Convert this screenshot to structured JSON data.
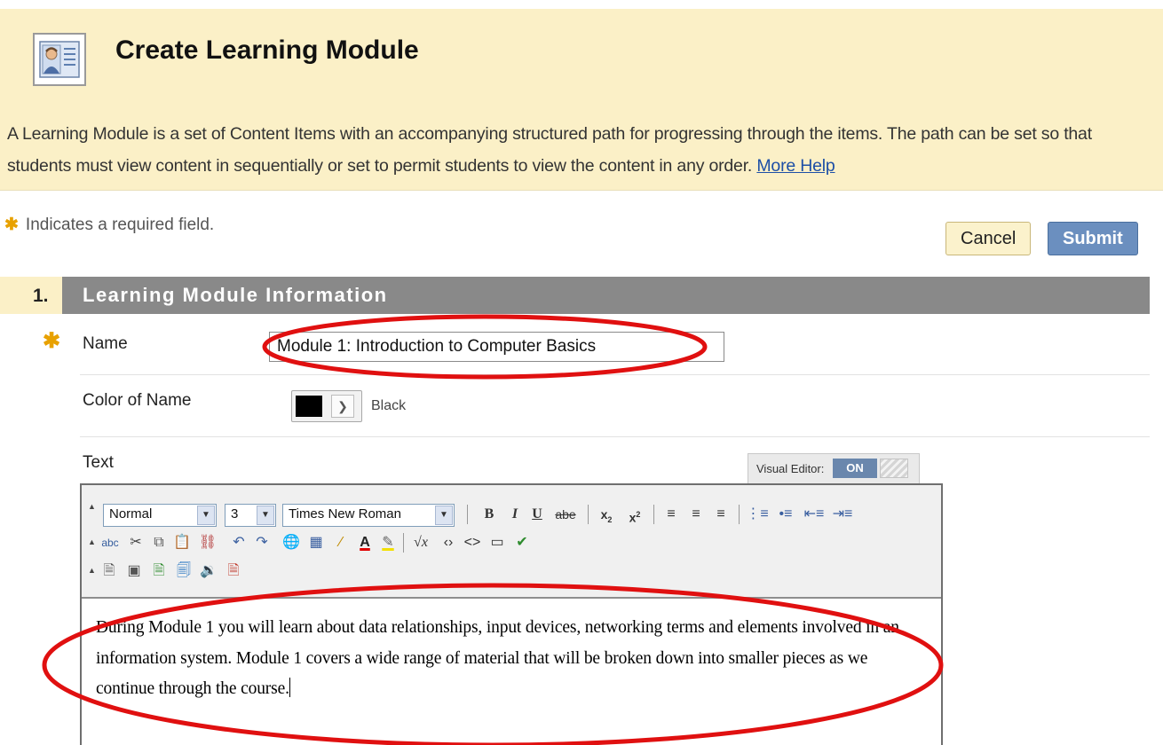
{
  "header": {
    "title": "Create Learning Module",
    "intro": "A Learning Module is a set of Content Items with an accompanying structured path for progressing through the items. The path can be set so that students must view content in sequentially or set to permit students to view the content in any order.",
    "more_help": "More Help"
  },
  "required_note": "Indicates a required field.",
  "buttons": {
    "cancel": "Cancel",
    "submit": "Submit"
  },
  "section": {
    "number": "1.",
    "title": "Learning Module Information"
  },
  "fields": {
    "name_label": "Name",
    "name_value": "Module 1: Introduction to Computer Basics",
    "color_label": "Color of Name",
    "color_value": "Black",
    "text_label": "Text"
  },
  "visual_editor": {
    "label": "Visual Editor:",
    "state": "ON"
  },
  "toolbar": {
    "format": "Normal",
    "size": "3",
    "font": "Times New Roman"
  },
  "editor_text": "During Module 1 you will learn about data relationships, input devices, networking terms and elements involved in an information system.  Module 1 covers a wide range of material that will be broken down into smaller pieces as we continue through the course.",
  "colors": {
    "header_bg": "#fbf0c7",
    "submit": "#6b8fbf",
    "section_bar": "#898989",
    "annotation": "#e01010",
    "required_star": "#e8a100"
  }
}
